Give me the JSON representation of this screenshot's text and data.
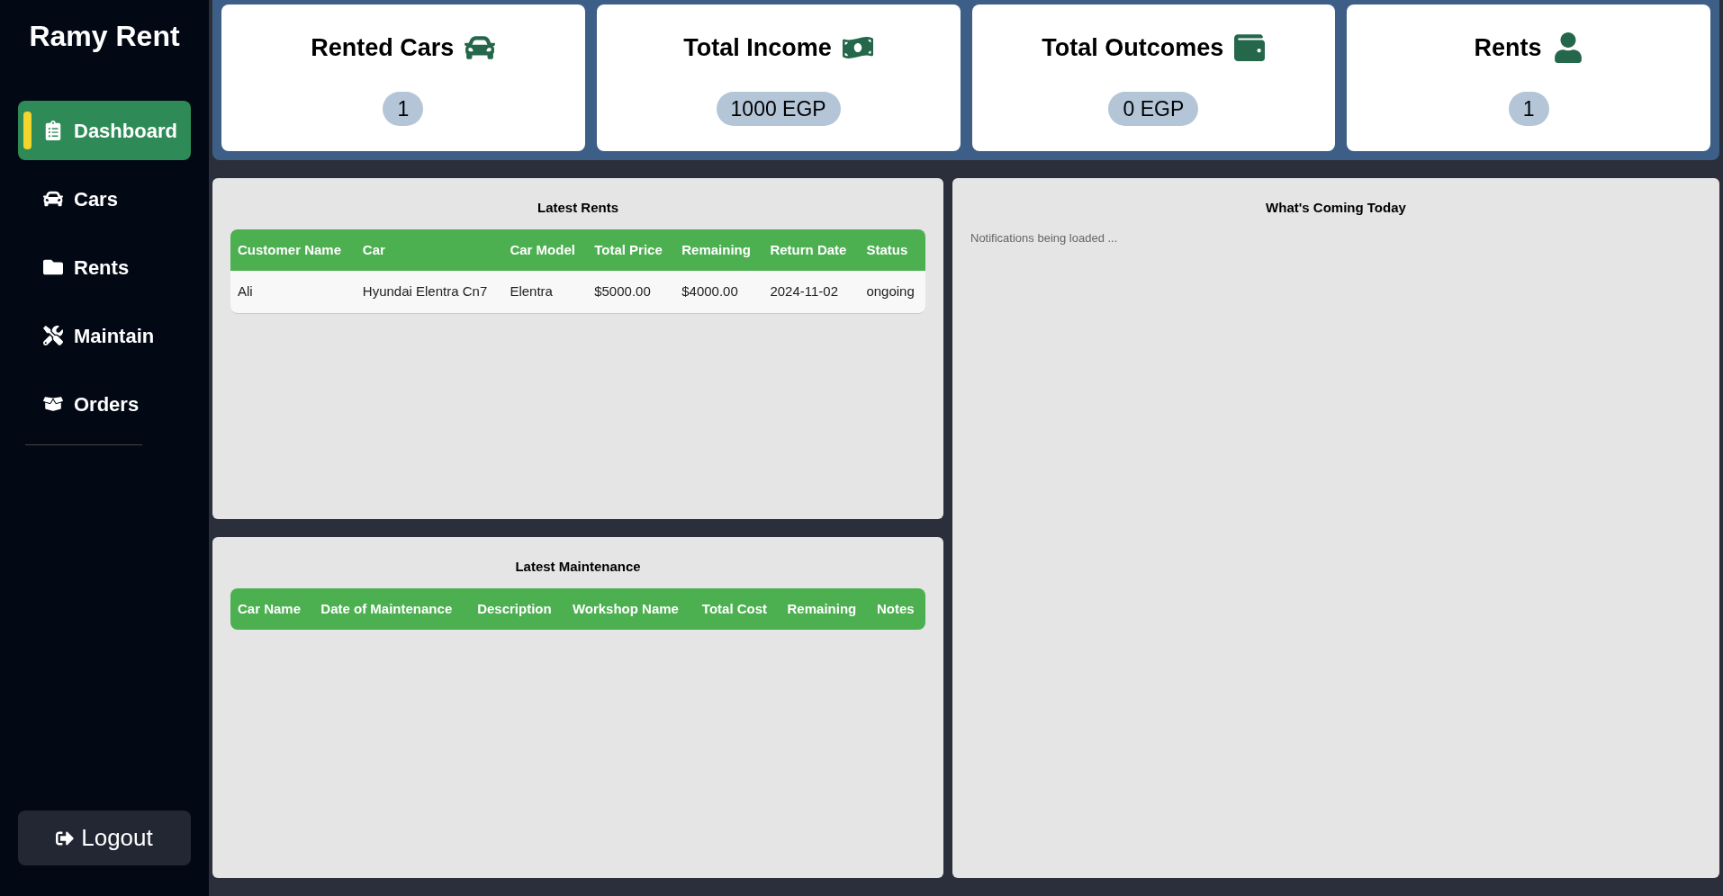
{
  "sidebar": {
    "brand": "Ramy Rent",
    "items": [
      {
        "label": "Dashboard",
        "selected": true
      },
      {
        "label": "Cars",
        "selected": false
      },
      {
        "label": "Rents",
        "selected": false
      },
      {
        "label": "Maintain",
        "selected": false
      },
      {
        "label": "Orders",
        "selected": false
      }
    ],
    "logout": "Logout"
  },
  "stats": [
    {
      "title": "Rented Cars",
      "value": "1"
    },
    {
      "title": "Total Income",
      "value": "1000 EGP"
    },
    {
      "title": "Total Outcomes",
      "value": "0 EGP"
    },
    {
      "title": "Rents",
      "value": "1"
    }
  ],
  "latest_rents": {
    "title": "Latest Rents",
    "columns": [
      "Customer Name",
      "Car",
      "Car Model",
      "Total Price",
      "Remaining",
      "Return Date",
      "Status"
    ],
    "rows": [
      [
        "Ali",
        "Hyundai Elentra Cn7",
        "Elentra",
        "$5000.00",
        "$4000.00",
        "2024-11-02",
        "ongoing"
      ]
    ]
  },
  "latest_maintenance": {
    "title": "Latest Maintenance",
    "columns": [
      "Car Name",
      "Date of Maintenance",
      "Description",
      "Workshop Name",
      "Total Cost",
      "Remaining",
      "Notes"
    ]
  },
  "coming_today": {
    "title": "What's Coming Today",
    "message": "Notifications being loaded ..."
  }
}
